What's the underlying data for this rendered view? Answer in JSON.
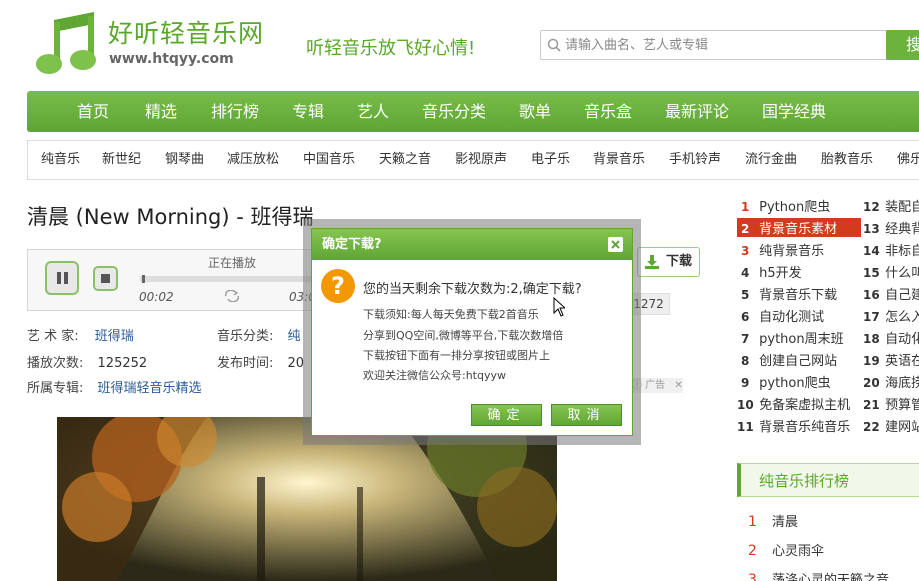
{
  "header": {
    "site_name": "好听轻音乐网",
    "site_url": "www.htqyy.com",
    "slogan": "听轻音乐放飞好心情!",
    "search_placeholder": "请输入曲名、艺人或专辑",
    "search_button": "搜"
  },
  "main_nav": [
    "首页",
    "精选",
    "排行榜",
    "专辑",
    "艺人",
    "音乐分类",
    "歌单",
    "音乐盒",
    "最新评论",
    "国学经典"
  ],
  "sub_nav": [
    "纯音乐",
    "新世纪",
    "钢琴曲",
    "减压放松",
    "中国音乐",
    "天籁之音",
    "影视原声",
    "电子乐",
    "背景音乐",
    "手机铃声",
    "流行金曲",
    "胎教音乐",
    "佛乐"
  ],
  "song": {
    "title": "清晨 (New Morning) - 班得瑞",
    "player_status": "正在播放",
    "current_time": "00:02",
    "total_time_partial": "03:0",
    "progress": 0.01
  },
  "meta": {
    "artist_label": "艺 术 家:",
    "artist": "班得瑞",
    "category_label": "音乐分类:",
    "category_partial": "纯",
    "plays_label": "播放次数:",
    "plays": "125252",
    "release_label": "发布时间:",
    "release_partial": "20",
    "album_label": "所属专辑:",
    "album": "班得瑞轻音乐精选"
  },
  "download_button": "下载",
  "count_badge": "1272",
  "ad_label": "广告",
  "modal": {
    "title": "确定下载?",
    "message": "您的当天剩余下载次数为:2,确定下载?",
    "lines": [
      "下载须知:每人每天免费下载2首音乐",
      "分享到QQ空间,微博等平台,下载次数增倍",
      "下载按钮下面有一排分享按钮或图片上",
      "欢迎关注微信公众号:htqyyw"
    ],
    "ok": "确定",
    "cancel": "取消"
  },
  "rank_left": [
    {
      "n": "1",
      "t": "Python爬虫"
    },
    {
      "n": "2",
      "t": "背景音乐素材"
    },
    {
      "n": "3",
      "t": "纯背景音乐"
    },
    {
      "n": "4",
      "t": "h5开发"
    },
    {
      "n": "5",
      "t": "背景音乐下载"
    },
    {
      "n": "6",
      "t": "自动化测试"
    },
    {
      "n": "7",
      "t": "python周末班"
    },
    {
      "n": "8",
      "t": "创建自己网站"
    },
    {
      "n": "9",
      "t": "python爬虫"
    },
    {
      "n": "10",
      "t": "免备案虚拟主机"
    },
    {
      "n": "11",
      "t": "背景音乐纯音乐"
    }
  ],
  "rank_right": [
    {
      "n": "12",
      "t": "装配自"
    },
    {
      "n": "13",
      "t": "经典背"
    },
    {
      "n": "14",
      "t": "非标自"
    },
    {
      "n": "15",
      "t": "什么叫"
    },
    {
      "n": "16",
      "t": "自己建"
    },
    {
      "n": "17",
      "t": "怎么入"
    },
    {
      "n": "18",
      "t": "自动化"
    },
    {
      "n": "19",
      "t": "英语在"
    },
    {
      "n": "20",
      "t": "海底捞"
    },
    {
      "n": "21",
      "t": "预算管"
    },
    {
      "n": "22",
      "t": "建网站"
    }
  ],
  "chart_box": {
    "title": "纯音乐排行榜",
    "items": [
      {
        "n": "1",
        "t": "清晨"
      },
      {
        "n": "2",
        "t": "心灵雨伞"
      },
      {
        "n": "3",
        "t": "荡涤心灵的天籁之音"
      }
    ]
  }
}
